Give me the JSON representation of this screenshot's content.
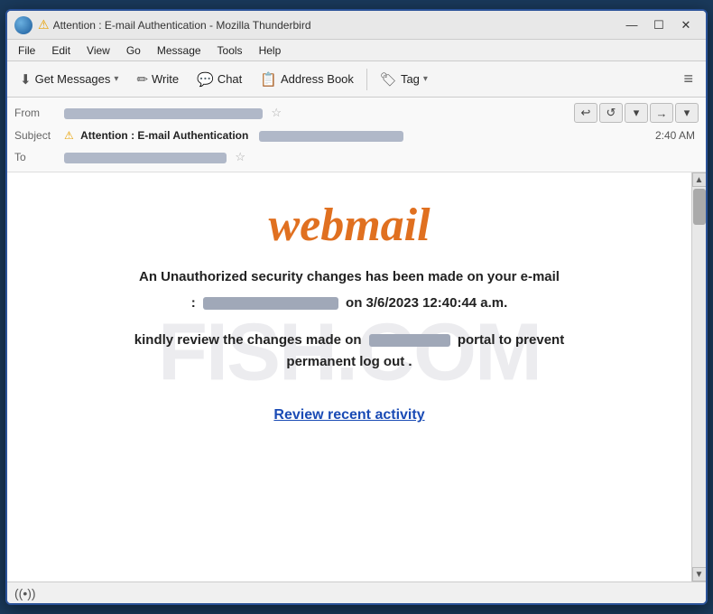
{
  "window": {
    "title": "Attention : E-mail Authentication - Mozilla Thunderbird",
    "title_display": "Attention : E-mail Authentication              - Mozilla Thunderbird"
  },
  "title_bar": {
    "warning_symbol": "⚠",
    "app_name": "Mozilla Thunderbird",
    "minimize": "—",
    "maximize": "☐",
    "close": "✕"
  },
  "menu": {
    "items": [
      "File",
      "Edit",
      "View",
      "Go",
      "Message",
      "Tools",
      "Help"
    ]
  },
  "toolbar": {
    "get_messages": "Get Messages",
    "write": "Write",
    "chat": "Chat",
    "address_book": "Address Book",
    "tag": "Tag",
    "hamburger": "≡"
  },
  "email_header": {
    "from_label": "From",
    "subject_label": "Subject",
    "to_label": "To",
    "warning_symbol": "⚠",
    "subject_text": "Attention : E-mail Authentication",
    "time": "2:40 AM"
  },
  "email_body": {
    "webmail_title": "webmail",
    "main_text_1": "An Unauthorized security changes has been made on your e-mail",
    "main_text_2": "on 3/6/2023 12:40:44 a.m.",
    "colon": ":",
    "sub_text_1": "kindly review the changes made on",
    "sub_text_2": "portal to prevent",
    "sub_text_3": "permanent log out .",
    "review_link": "Review recent activity",
    "watermark": "FISH.COM"
  },
  "status_bar": {
    "icon": "((•))"
  },
  "nav_buttons": {
    "reply_back": "↩",
    "reply_all": "↺",
    "dropdown": "▾",
    "forward": "→",
    "more": "▾"
  }
}
